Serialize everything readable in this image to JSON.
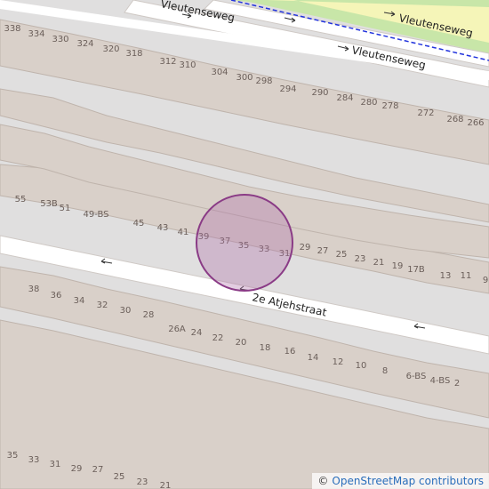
{
  "map": {
    "colors": {
      "background": "#e0dfdf",
      "building": "#d9d0c9",
      "building_edge": "#bfb4ac",
      "road": "#ffffff",
      "road_edge": "#cfc9c5",
      "green": "#c8e6a8",
      "cycleway_yellow": "#f5f5b8",
      "cycleway_dash": "#2233dd",
      "marker_fill": "#b070a8",
      "marker_stroke": "#8a3b86",
      "label": "#6b5f5a"
    },
    "streets": {
      "top_west": "Vleutenseweg",
      "top_east": "Vleutenseweg",
      "middle": "Vleutenseweg",
      "bottom": "2e Atjehstraat"
    },
    "house_numbers": {
      "row_north": [
        "338",
        "334",
        "330",
        "324",
        "320",
        "318",
        "312",
        "310",
        "304",
        "300",
        "298",
        "294",
        "290",
        "284",
        "280",
        "278",
        "272",
        "268",
        "266"
      ],
      "row_middle": [
        "55",
        "53B",
        "51",
        "49-BS",
        "45",
        "43",
        "41",
        "39",
        "37",
        "35",
        "33",
        "31",
        "29",
        "27",
        "25",
        "23",
        "21",
        "19",
        "17B",
        "13",
        "11",
        "9"
      ],
      "row_south": [
        "38",
        "36",
        "34",
        "32",
        "30",
        "28",
        "26A",
        "24",
        "22",
        "20",
        "18",
        "16",
        "14",
        "12",
        "10",
        "8",
        "6-BS",
        "4-BS",
        "2"
      ],
      "row_bottom": [
        "35",
        "33",
        "31",
        "29",
        "27",
        "25",
        "23",
        "21"
      ]
    },
    "marker": {
      "label": "location-marker"
    },
    "attribution": {
      "symbol": "©",
      "text": "OpenStreetMap contributors"
    }
  }
}
